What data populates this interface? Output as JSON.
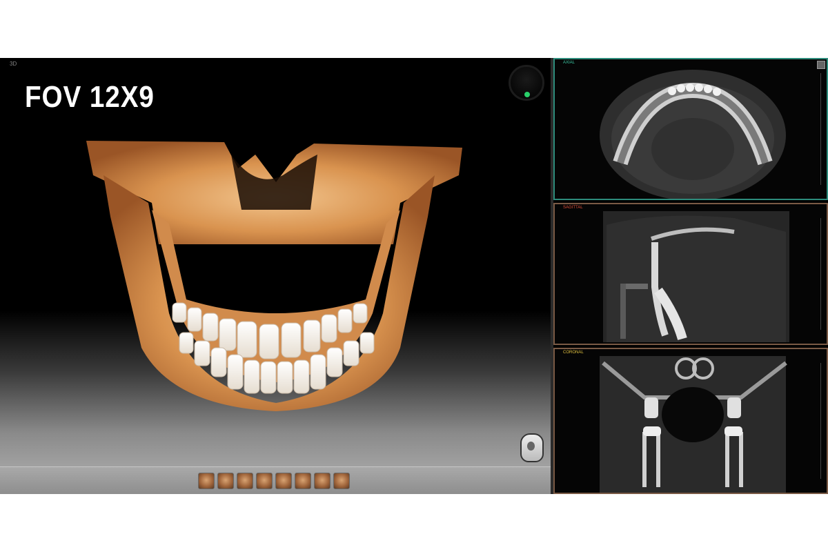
{
  "title": {
    "fov": "FOV 12X9"
  },
  "panels": {
    "view3d": {
      "corner_label": "3D"
    },
    "axial": {
      "label": "AXIAL"
    },
    "sagittal": {
      "label": "SAGITTAL"
    },
    "coronal": {
      "label": "CORONAL"
    }
  },
  "thumbnails": {
    "count": 8
  },
  "colors": {
    "axial_border": "#2d8c7c",
    "sagittal_border": "#7a5a45",
    "coronal_border": "#7a5a45",
    "orientation_dot": "#29d06a",
    "bone_render": "#d4924e"
  }
}
